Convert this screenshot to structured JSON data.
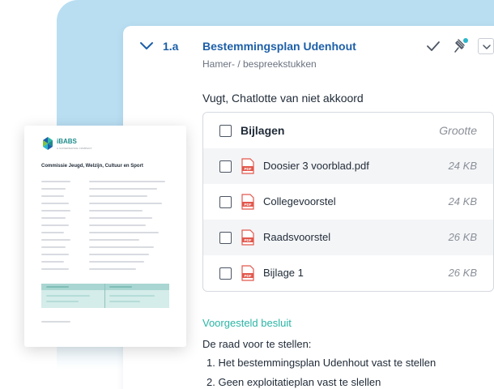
{
  "agenda_item": {
    "number": "1.a",
    "title": "Bestemmingsplan Udenhout",
    "subtitle": "Hamer- / bespreekstukken",
    "assignee_line": "Vugt, Chatlotte van niet akkoord"
  },
  "toolbar_icons": [
    "check-icon",
    "pin-icon",
    "chevron-down-icon"
  ],
  "attachments": {
    "header_label": "Bijlagen",
    "header_size": "Grootte",
    "files": [
      {
        "name": "Doosier 3 voorblad.pdf",
        "size": "24 KB"
      },
      {
        "name": "Collegevoorstel",
        "size": "24 KB"
      },
      {
        "name": "Raadsvoorstel",
        "size": "26 KB"
      },
      {
        "name": "Bijlage 1",
        "size": "26 KB"
      }
    ],
    "pdf_icon_text": "PDF"
  },
  "proposal": {
    "title": "Voorgesteld besluit",
    "intro": "De raad voor te stellen:",
    "items": [
      "1. Het bestemmingsplan Udenhout vast te stellen",
      "2. Geen exploitatieplan vast te slellen"
    ]
  },
  "document_preview": {
    "brand": "iBABS",
    "brand_sub": "A GOVERNANCE COMPANY",
    "heading": "Commissie Jeugd, Welzijn, Cultuur en Sport"
  },
  "colors": {
    "accent_blue": "#1d5fa8",
    "accent_teal": "#2bb5a6",
    "background_blue": "#b9def2",
    "pdf_red": "#e2574c"
  }
}
